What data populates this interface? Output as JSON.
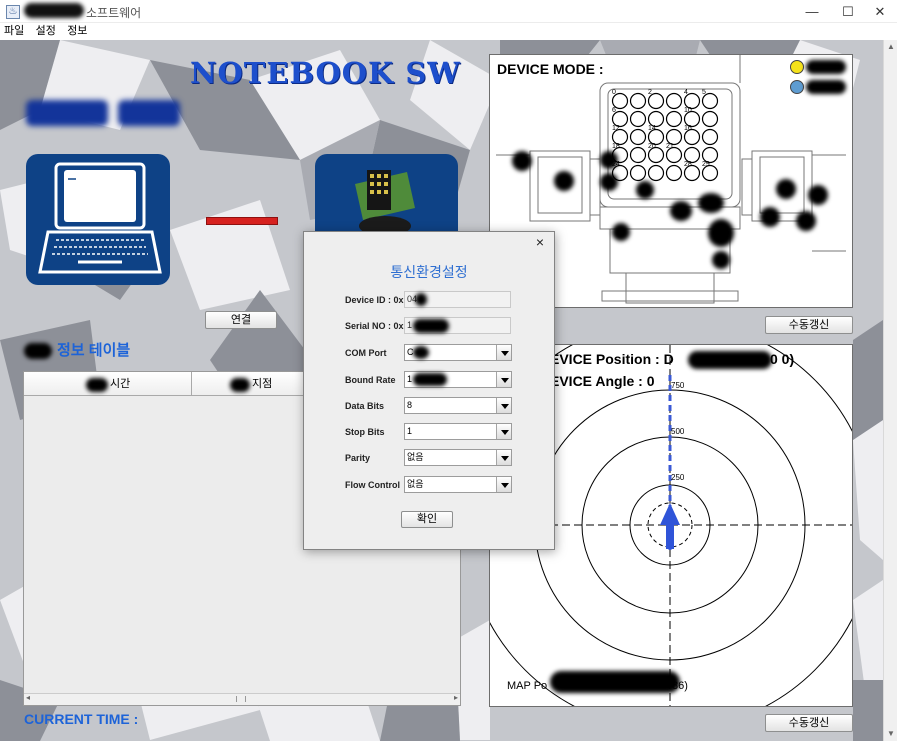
{
  "window": {
    "title": "소프트웨어",
    "min_label": "—",
    "max_label": "☐",
    "close_label": "✕"
  },
  "menu": {
    "items": [
      "파일",
      "설정",
      "정보"
    ]
  },
  "logo": {
    "text": "NOTEBOOK SW"
  },
  "connect_button": "연결",
  "table_section": {
    "title": "정보 테이블",
    "columns": [
      "시간",
      "지점"
    ]
  },
  "current_time_label": "CURRENT TIME :",
  "device_mode": {
    "title": "DEVICE MODE :",
    "legend": [
      {
        "color": "#f5e21b",
        "label": ""
      },
      {
        "color": "#5e9cd1",
        "label": ""
      }
    ],
    "cell_numbers": [
      "0",
      "",
      "2",
      "",
      "4",
      "5",
      "6",
      "",
      "",
      "",
      "10",
      "",
      "12",
      "",
      "14",
      "",
      "16",
      "",
      "18",
      "",
      "20",
      "21",
      "",
      "",
      "24",
      "",
      "",
      "",
      "28",
      "29"
    ]
  },
  "refresh_button": "수동갱신",
  "map": {
    "position_label": "EVICE Position : D",
    "position_value": "0 0)",
    "angle_label": "EVICE Angle : 0",
    "ring_labels": [
      "750",
      "500",
      "250"
    ],
    "footer": "MAP Po",
    "footer_value": "86)"
  },
  "dialog": {
    "close_label": "×",
    "title": "통신환경설정",
    "fields": [
      {
        "label": "Device ID : 0x",
        "value": "04",
        "type": "text"
      },
      {
        "label": "Serial NO : 0x",
        "value": "1",
        "type": "text"
      },
      {
        "label": "COM Port",
        "value": "C",
        "type": "combo"
      },
      {
        "label": "Bound Rate",
        "value": "1",
        "type": "combo"
      },
      {
        "label": "Data Bits",
        "value": "8",
        "type": "combo"
      },
      {
        "label": "Stop Bits",
        "value": "1",
        "type": "combo"
      },
      {
        "label": "Parity",
        "value": "없음",
        "type": "combo"
      },
      {
        "label": "Flow Control",
        "value": "없음",
        "type": "combo"
      }
    ],
    "ok_button": "확인"
  }
}
